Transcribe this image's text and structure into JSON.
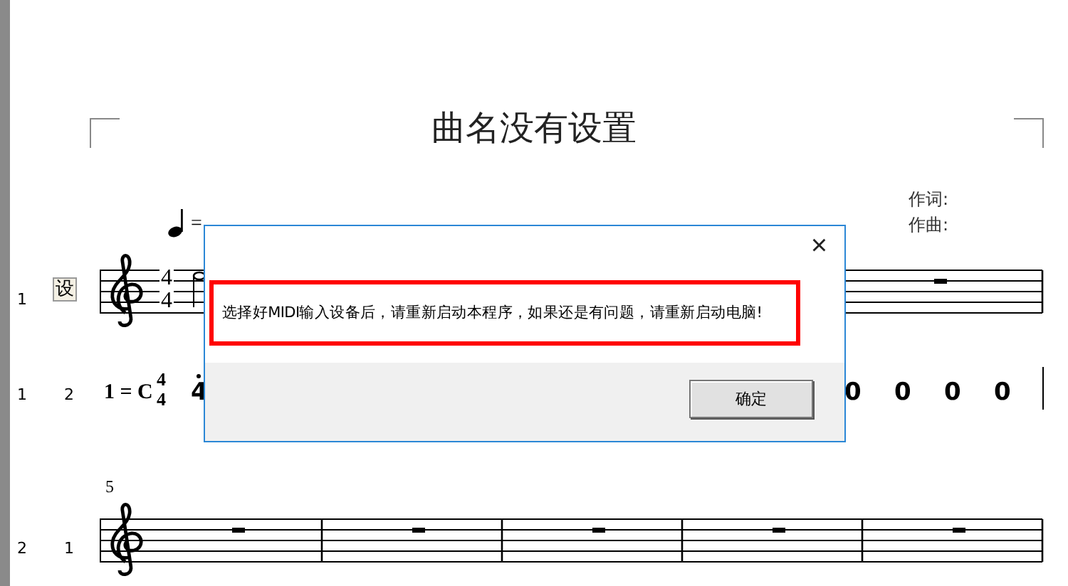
{
  "page": {
    "title": "曲名没有设置",
    "lyricist": "作词:",
    "composer": "作曲:"
  },
  "systems": [
    {
      "kind": "staff",
      "labels": [
        "1"
      ],
      "button": "设",
      "tempo": "=",
      "time_signature": [
        "4",
        "4"
      ],
      "measures": [
        {
          "kind": "rest"
        }
      ]
    },
    {
      "kind": "numbered",
      "labels": [
        "1",
        "2"
      ],
      "key": "1 = C",
      "time_signature": [
        "4",
        "4"
      ],
      "notes": [
        "4",
        "0",
        "0",
        "0",
        "0"
      ]
    },
    {
      "kind": "staff",
      "measure_number": "5",
      "labels": [
        "2",
        "1"
      ],
      "measures": [
        {
          "kind": "rest"
        },
        {
          "kind": "rest"
        },
        {
          "kind": "rest"
        },
        {
          "kind": "rest"
        },
        {
          "kind": "rest"
        }
      ]
    }
  ],
  "dialog": {
    "close": "×",
    "message": "选择好MIDI输入设备后，请重新启动本程序，如果还是有问题，请重新启动电脑!",
    "button": "确定"
  }
}
